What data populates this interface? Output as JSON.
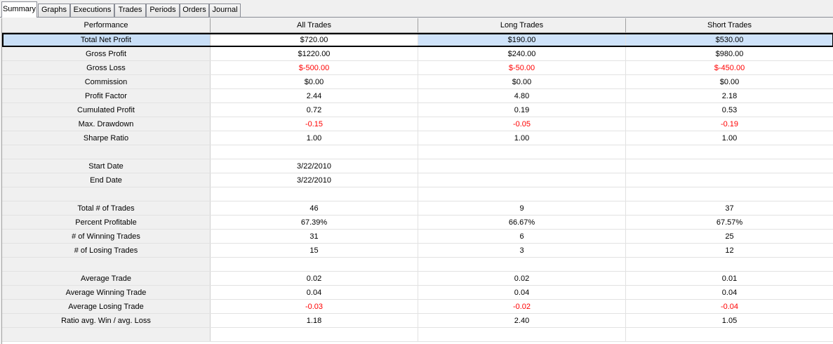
{
  "tabs": [
    "Summary",
    "Graphs",
    "Executions",
    "Trades",
    "Periods",
    "Orders",
    "Journal"
  ],
  "active_tab": "Summary",
  "columns": [
    "Performance",
    "All Trades",
    "Long Trades",
    "Short Trades"
  ],
  "rows": [
    {
      "label": "Total Net Profit",
      "values": [
        "$720.00",
        "$190.00",
        "$530.00"
      ],
      "negative": false,
      "selected": true
    },
    {
      "label": "Gross Profit",
      "values": [
        "$1220.00",
        "$240.00",
        "$980.00"
      ],
      "negative": false
    },
    {
      "label": "Gross Loss",
      "values": [
        "$-500.00",
        "$-50.00",
        "$-450.00"
      ],
      "negative": true
    },
    {
      "label": "Commission",
      "values": [
        "$0.00",
        "$0.00",
        "$0.00"
      ],
      "negative": false
    },
    {
      "label": "Profit Factor",
      "values": [
        "2.44",
        "4.80",
        "2.18"
      ],
      "negative": false
    },
    {
      "label": "Cumulated Profit",
      "values": [
        "0.72",
        "0.19",
        "0.53"
      ],
      "negative": false
    },
    {
      "label": "Max. Drawdown",
      "values": [
        "-0.15",
        "-0.05",
        "-0.19"
      ],
      "negative": true
    },
    {
      "label": "Sharpe Ratio",
      "values": [
        "1.00",
        "1.00",
        "1.00"
      ],
      "negative": false
    },
    {
      "label": "",
      "values": [
        "",
        "",
        ""
      ],
      "negative": false
    },
    {
      "label": "Start Date",
      "values": [
        "3/22/2010",
        "",
        ""
      ],
      "negative": false
    },
    {
      "label": "End Date",
      "values": [
        "3/22/2010",
        "",
        ""
      ],
      "negative": false
    },
    {
      "label": "",
      "values": [
        "",
        "",
        ""
      ],
      "negative": false
    },
    {
      "label": "Total # of Trades",
      "values": [
        "46",
        "9",
        "37"
      ],
      "negative": false
    },
    {
      "label": "Percent Profitable",
      "values": [
        "67.39%",
        "66.67%",
        "67.57%"
      ],
      "negative": false
    },
    {
      "label": "# of Winning Trades",
      "values": [
        "31",
        "6",
        "25"
      ],
      "negative": false
    },
    {
      "label": "# of Losing Trades",
      "values": [
        "15",
        "3",
        "12"
      ],
      "negative": false
    },
    {
      "label": "",
      "values": [
        "",
        "",
        ""
      ],
      "negative": false
    },
    {
      "label": "Average Trade",
      "values": [
        "0.02",
        "0.02",
        "0.01"
      ],
      "negative": false
    },
    {
      "label": "Average Winning Trade",
      "values": [
        "0.04",
        "0.04",
        "0.04"
      ],
      "negative": false
    },
    {
      "label": "Average Losing Trade",
      "values": [
        "-0.03",
        "-0.02",
        "-0.04"
      ],
      "negative": true
    },
    {
      "label": "Ratio avg. Win / avg. Loss",
      "values": [
        "1.18",
        "2.40",
        "1.05"
      ],
      "negative": false
    },
    {
      "label": "",
      "values": [
        "",
        "",
        ""
      ],
      "negative": false
    }
  ],
  "colors": {
    "negative": "#ff0000",
    "selection": "#cfe3fa",
    "header_bg": "#f0f0f0"
  }
}
